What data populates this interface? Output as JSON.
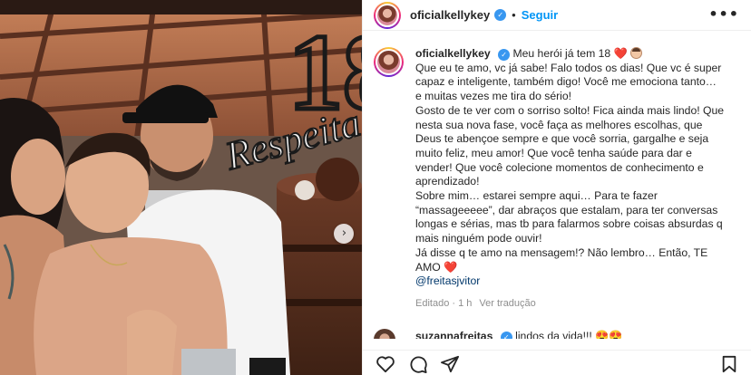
{
  "post": {
    "username": "oficialkellykey",
    "verified_glyph": "✓",
    "separator": "•",
    "follow_label": "Seguir",
    "more_label": "•••"
  },
  "caption": {
    "username": "oficialkellykey",
    "lines": [
      "Meu herói já tem 18",
      "Que eu te amo, vc já sabe! Falo todos os dias! Que vc é super",
      "capaz e inteligente, também digo! Você me emociona tanto…",
      "e muitas vezes me tira do sério!",
      "Gosto de te ver com o sorriso solto! Fica ainda mais lindo! Que",
      "nesta sua nova fase, você faça as melhores escolhas, que",
      "Deus te abençoe sempre e que você sorria, gargalhe e seja",
      "muito feliz, meu amor! Que você tenha saúde para dar e",
      "vender! Que você colecione momentos de conhecimento e",
      "aprendizado!",
      "Sobre mim… estarei sempre aqui… Para te fazer",
      "“massageeeee”, dar abraços que estalam, para ter conversas",
      "longas e sérias, mas tb para falarmos sobre coisas absurdas q",
      "mais ninguém pode ouvir!",
      "Já disse q te amo na mensagem!? Não lembro… Então, TE",
      "AMO"
    ],
    "heart": "❤️",
    "mention": "@freitasjvitor",
    "edited": "Editado",
    "dot": "·",
    "time": "1 h",
    "translate": "Ver tradução"
  },
  "comment": {
    "username": "suzannafreitas",
    "text": "lindos da vida!!!",
    "emojis": "😍😍"
  },
  "photo": {
    "cake_topper_text": "18",
    "topper_script": "Respeita"
  },
  "icons": {
    "like": "heart-icon",
    "comment": "comment-icon",
    "share": "share-icon",
    "save": "bookmark-icon",
    "next": "chevron-right-icon"
  },
  "colors": {
    "follow_blue": "#0095f6",
    "verified_blue": "#3897f0",
    "heart_red": "#ed4956",
    "mention_blue": "#00376b",
    "meta_gray": "#8e8e8e"
  }
}
